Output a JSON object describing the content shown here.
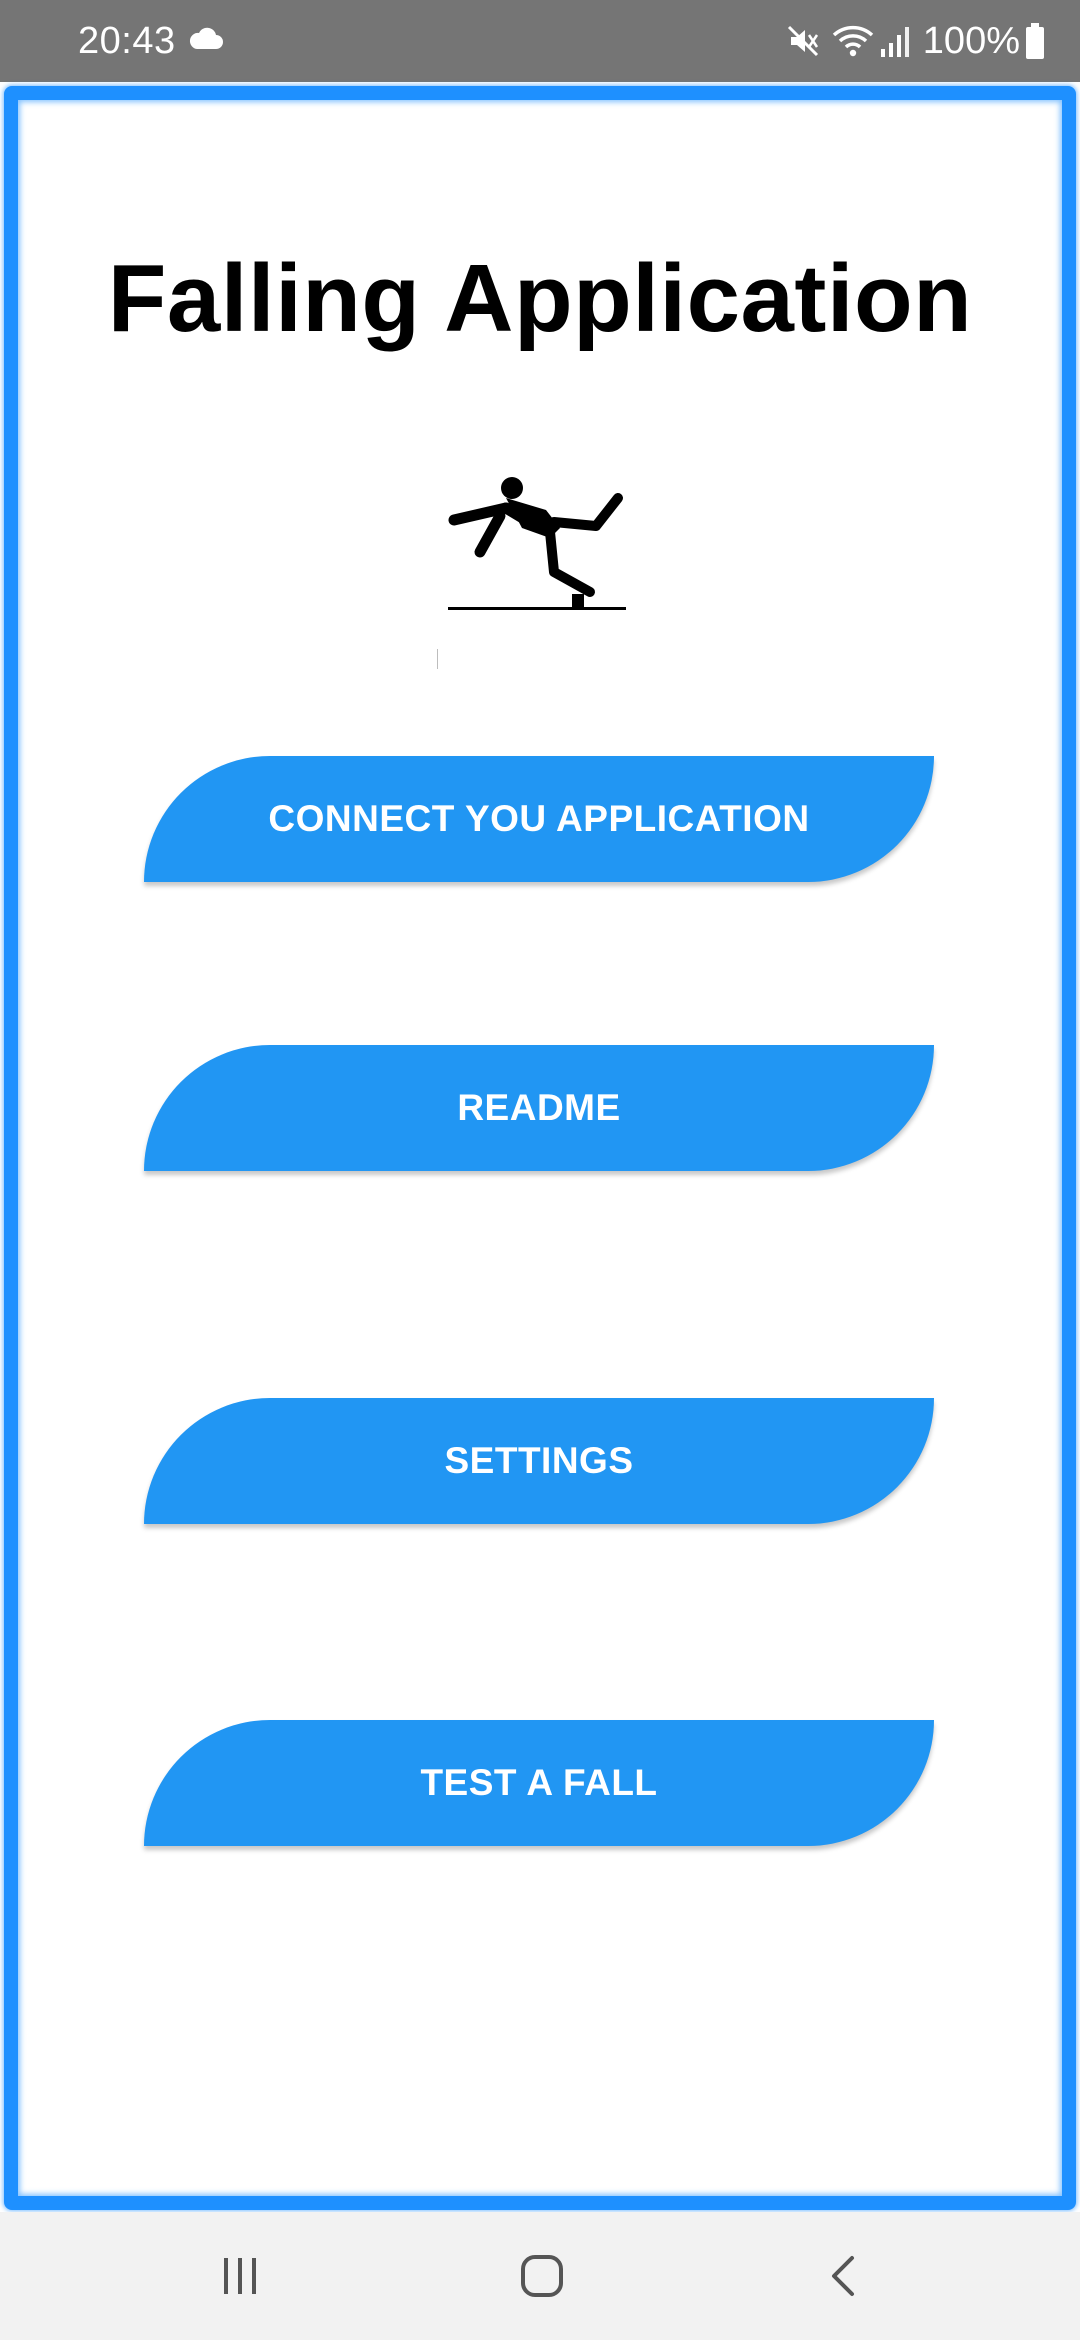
{
  "status_bar": {
    "time": "20:43",
    "battery": "100%",
    "icons": [
      "cloud-icon",
      "mute-icon",
      "wifi-icon",
      "signal-icon",
      "battery-icon"
    ]
  },
  "app": {
    "title": "Falling Application",
    "logo_icon": "person-falling-icon",
    "accent_color": "#2196f3",
    "frame_color": "#1e90ff"
  },
  "buttons": {
    "connect": "CONNECT YOU APPLICATION",
    "readme": "README",
    "settings": "SETTINGS",
    "test_fall": "TEST A FALL"
  },
  "nav_bar": {
    "icons": [
      "recents-icon",
      "home-icon",
      "back-icon"
    ]
  }
}
